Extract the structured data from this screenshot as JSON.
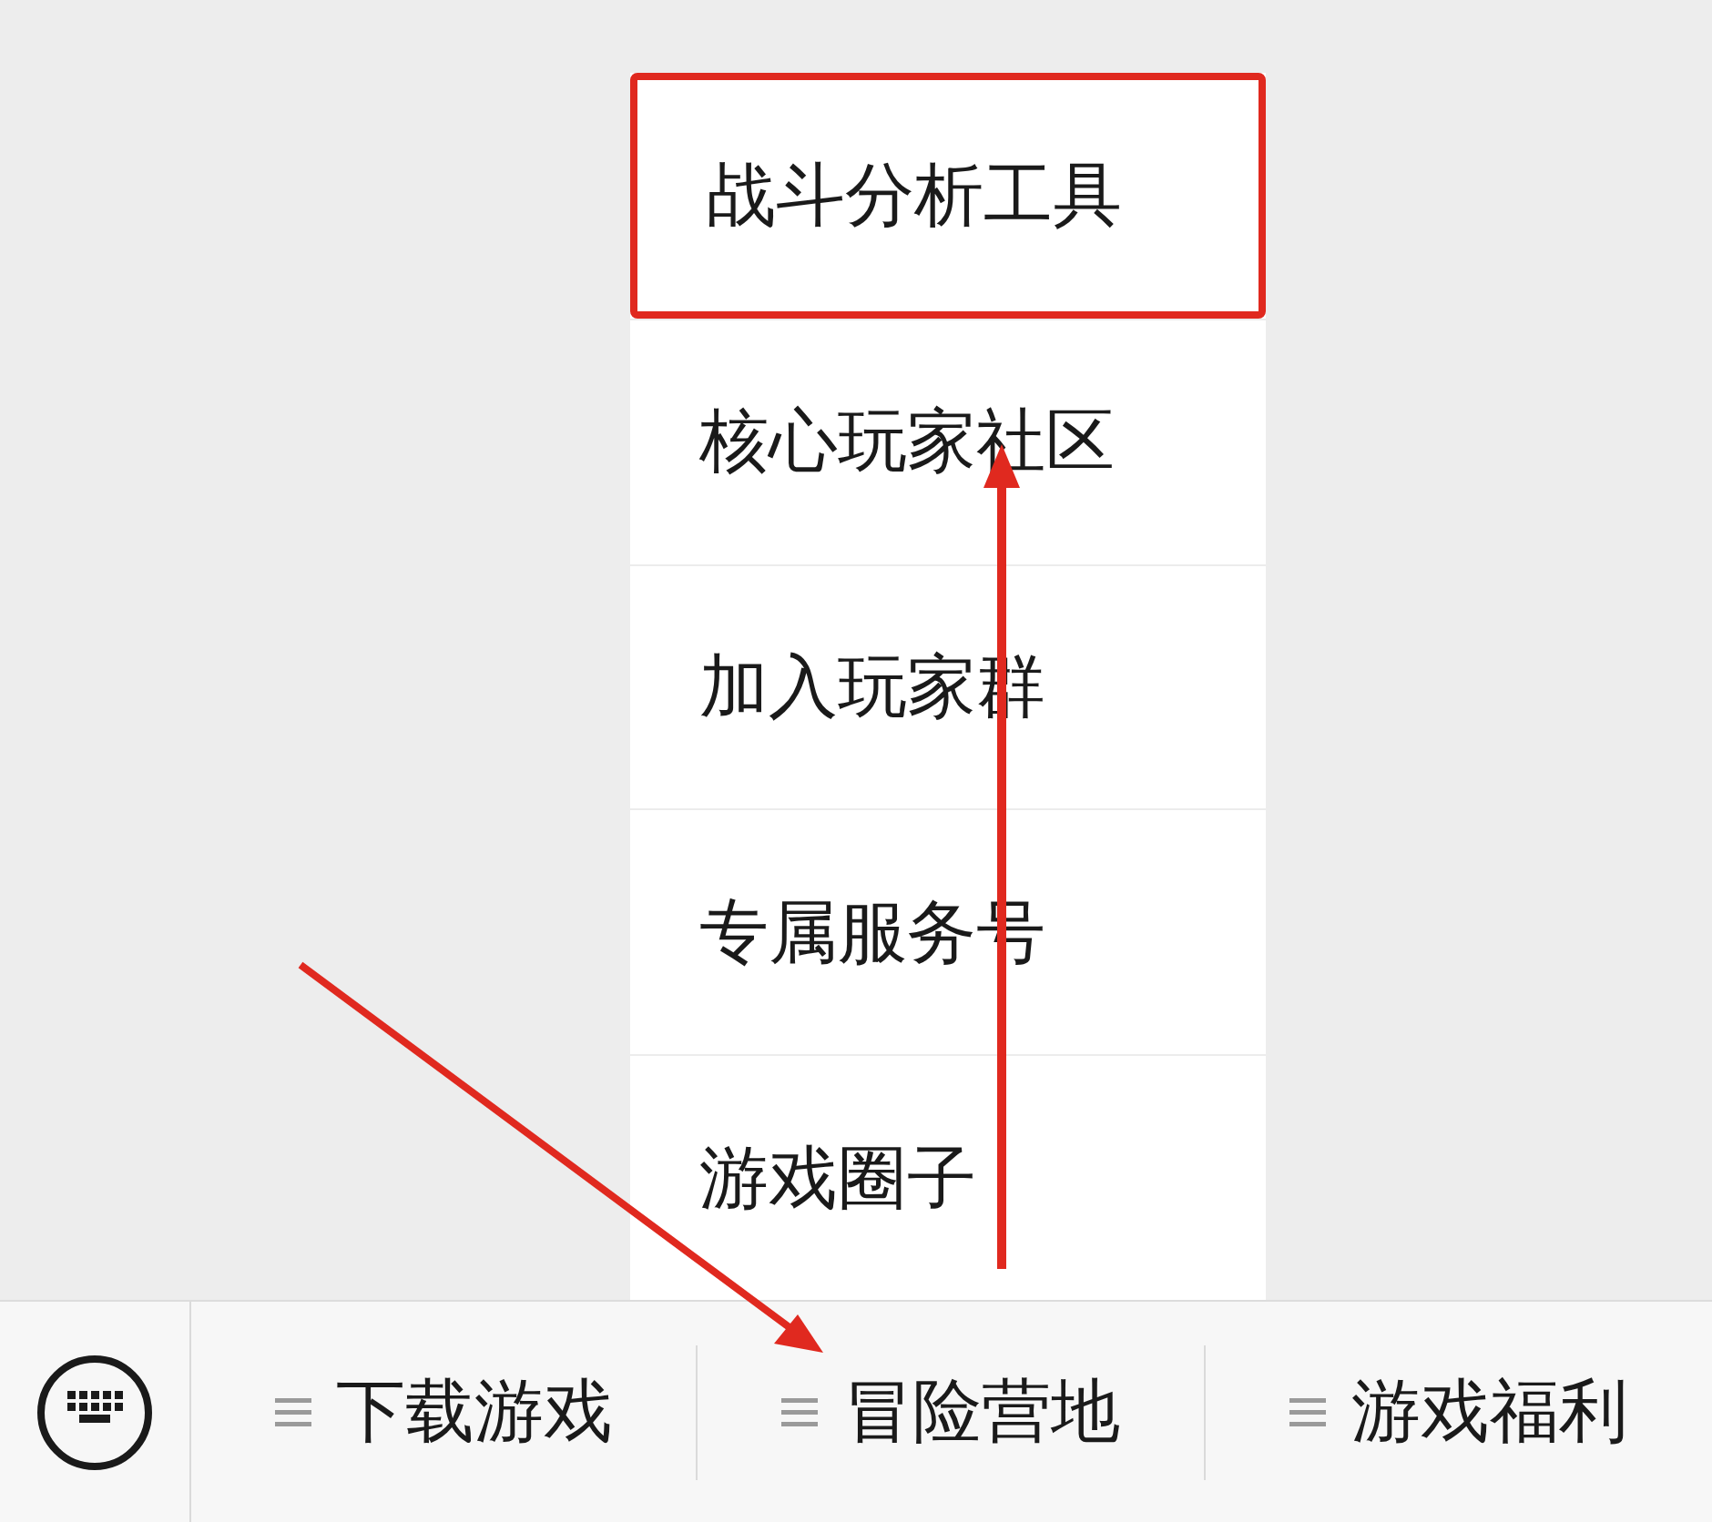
{
  "popup_menu": {
    "items": [
      {
        "label": "战斗分析工具",
        "highlighted": true
      },
      {
        "label": "核心玩家社区",
        "highlighted": false
      },
      {
        "label": "加入玩家群",
        "highlighted": false
      },
      {
        "label": "专属服务号",
        "highlighted": false
      },
      {
        "label": "游戏圈子",
        "highlighted": false
      }
    ]
  },
  "bottom_menu": {
    "tabs": [
      {
        "label": "下载游戏"
      },
      {
        "label": "冒险营地"
      },
      {
        "label": "游戏福利"
      }
    ]
  }
}
